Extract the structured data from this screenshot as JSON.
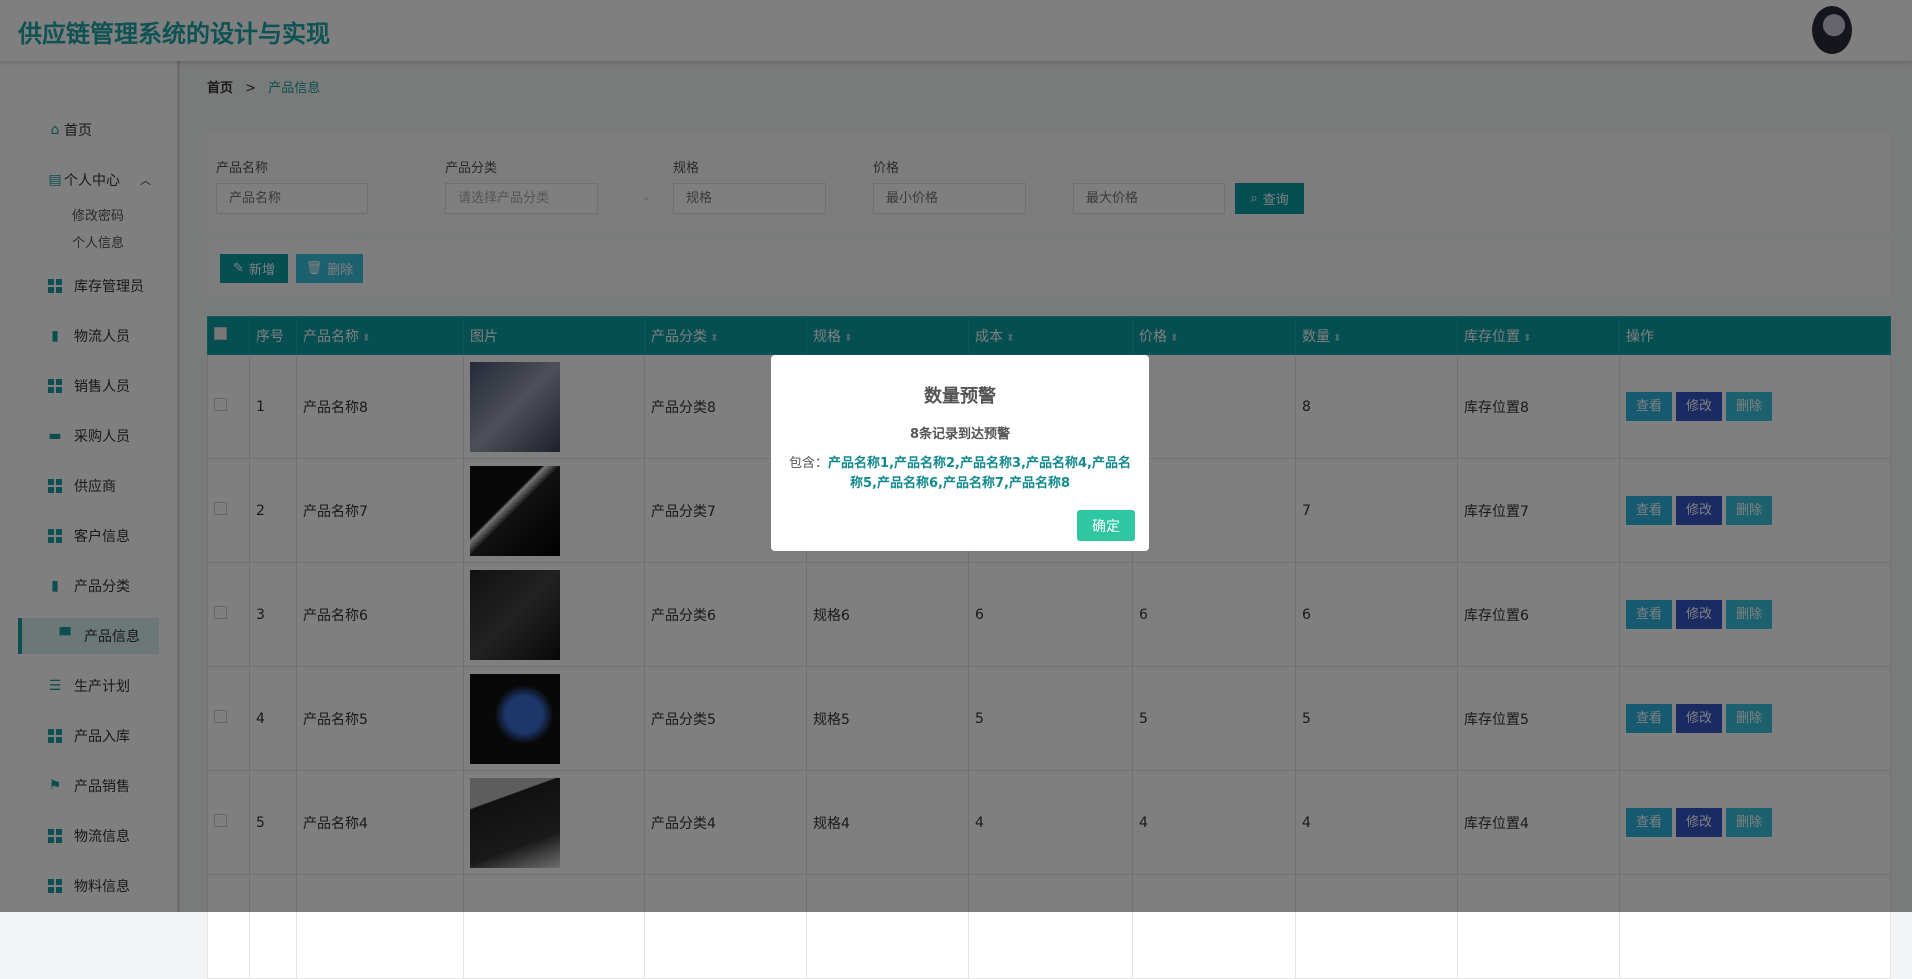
{
  "header": {
    "title": "供应链管理系统的设计与实现"
  },
  "breadcrumb": {
    "home": "首页",
    "sep": ">",
    "current": "产品信息"
  },
  "sidebar": {
    "home": "首页",
    "personal": "个人中心",
    "change_password": "修改密码",
    "personal_info": "个人信息",
    "items": [
      "库存管理员",
      "物流人员",
      "销售人员",
      "采购人员",
      "供应商",
      "客户信息",
      "产品分类",
      "产品信息",
      "生产计划",
      "产品入库",
      "产品销售",
      "物流信息",
      "物料信息"
    ],
    "active": "产品信息"
  },
  "search": {
    "name_label": "产品名称",
    "name_placeholder": "产品名称",
    "category_label": "产品分类",
    "category_placeholder": "请选择产品分类",
    "spec_label": "规格",
    "spec_placeholder": "规格",
    "price_label": "价格",
    "min_price_placeholder": "最小价格",
    "max_price_placeholder": "最大价格",
    "query_button": "查询"
  },
  "toolbar": {
    "add": "新增",
    "delete": "删除"
  },
  "table": {
    "columns": [
      "序号",
      "产品名称",
      "图片",
      "产品分类",
      "规格",
      "成本",
      "价格",
      "数量",
      "库存位置",
      "操作"
    ],
    "actions": {
      "view": "查看",
      "edit": "修改",
      "delete": "删除"
    },
    "rows": [
      {
        "index": "1",
        "name": "产品名称8",
        "category": "产品分类8",
        "spec": "",
        "cost": "",
        "price": "",
        "qty": "8",
        "location": "库存位置8"
      },
      {
        "index": "2",
        "name": "产品名称7",
        "category": "产品分类7",
        "spec": "",
        "cost": "",
        "price": "",
        "qty": "7",
        "location": "库存位置7"
      },
      {
        "index": "3",
        "name": "产品名称6",
        "category": "产品分类6",
        "spec": "规格6",
        "cost": "6",
        "price": "6",
        "qty": "6",
        "location": "库存位置6"
      },
      {
        "index": "4",
        "name": "产品名称5",
        "category": "产品分类5",
        "spec": "规格5",
        "cost": "5",
        "price": "5",
        "qty": "5",
        "location": "库存位置5"
      },
      {
        "index": "5",
        "name": "产品名称4",
        "category": "产品分类4",
        "spec": "规格4",
        "cost": "4",
        "price": "4",
        "qty": "4",
        "location": "库存位置4"
      }
    ]
  },
  "modal": {
    "title": "数量预警",
    "subtitle": "8条记录到达预警",
    "prefix": "包含：",
    "items": "产品名称1,产品名称2,产品名称3,产品名称4,产品名称5,产品名称6,产品名称7,产品名称8",
    "ok": "确定"
  },
  "colors": {
    "accent": "#0a9da2",
    "view": "#2fb3df",
    "edit": "#3456c9",
    "delete": "#3cc3dc",
    "ok": "#2ec7a1"
  }
}
